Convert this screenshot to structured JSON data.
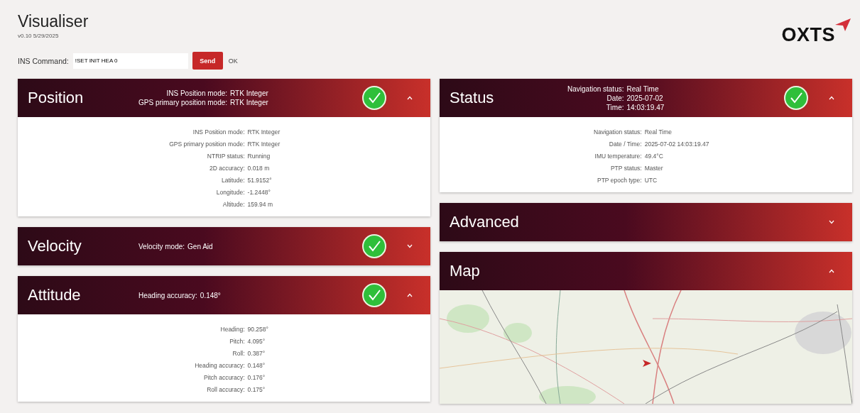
{
  "app": {
    "title": "Visualiser",
    "version": "v0.10  5/29/2025",
    "logo": "OXTS"
  },
  "command": {
    "label": "INS Command:",
    "value": "!SET INIT HEA 0",
    "button": "Send",
    "response": "OK"
  },
  "columns": [
    [
      {
        "kind": "fields",
        "title": "Position",
        "ok": true,
        "expanded": true,
        "summary": [
          {
            "label": "INS Position mode:",
            "value": "RTK Integer"
          },
          {
            "label": "GPS primary position mode:",
            "value": "RTK Integer"
          }
        ],
        "rows": [
          {
            "label": "INS Position mode:",
            "value": "RTK Integer"
          },
          {
            "label": "GPS primary position mode:",
            "value": "RTK Integer"
          },
          {
            "label": "NTRIP status:",
            "value": "Running"
          },
          {
            "label": "2D accuracy:",
            "value": "0.018 m"
          },
          {
            "label": "Latitude:",
            "value": "51.9152°"
          },
          {
            "label": "Longitude:",
            "value": "-1.2448°"
          },
          {
            "label": "Altitude:",
            "value": "159.94 m"
          }
        ]
      },
      {
        "title": "Velocity",
        "ok": true,
        "expanded": false,
        "summary": [
          {
            "label": "Velocity mode:",
            "value": "Gen Aid"
          }
        ]
      },
      {
        "kind": "fields",
        "title": "Attitude",
        "ok": true,
        "expanded": true,
        "summary": [
          {
            "label": "Heading accuracy:",
            "value": "0.148°"
          }
        ],
        "rows": [
          {
            "label": "Heading:",
            "value": "90.258°"
          },
          {
            "label": "Pitch:",
            "value": "4.095°"
          },
          {
            "label": "Roll:",
            "value": "0.387°"
          },
          {
            "label": "Heading accuracy:",
            "value": "0.148°"
          },
          {
            "label": "Pitch accuracy:",
            "value": "0.176°"
          },
          {
            "label": "Roll accuracy:",
            "value": "0.175°"
          }
        ]
      }
    ],
    [
      {
        "kind": "fields",
        "title": "Status",
        "ok": true,
        "expanded": true,
        "summary": [
          {
            "label": "Navigation status:",
            "value": "Real Time"
          },
          {
            "label": "Date:",
            "value": "2025-07-02"
          },
          {
            "label": "Time:",
            "value": "14:03:19.47"
          }
        ],
        "rows": [
          {
            "label": "Navigation status:",
            "value": "Real Time"
          },
          {
            "label": "Date / Time:",
            "value": "2025-07-02 14:03:19.47"
          },
          {
            "label": "IMU temperature:",
            "value": "49.4°C"
          },
          {
            "label": "PTP status:",
            "value": "Master"
          },
          {
            "label": "PTP epoch type:",
            "value": "UTC"
          }
        ]
      },
      {
        "title": "Advanced",
        "expanded": false
      },
      {
        "kind": "map",
        "title": "Map",
        "expanded": true
      }
    ]
  ]
}
